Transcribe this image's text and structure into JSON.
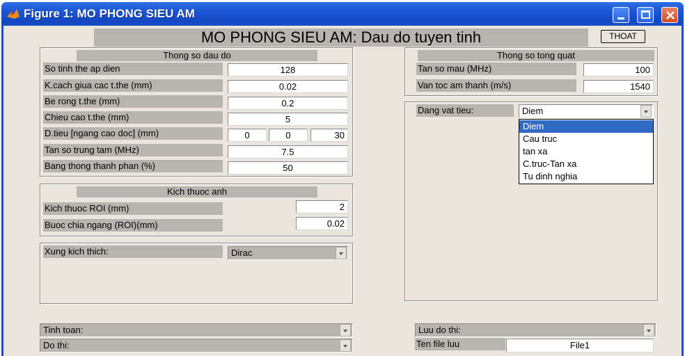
{
  "window": {
    "title": "Figure 1: MO PHONG SIEU AM"
  },
  "heading": "MO PHONG SIEU AM: Dau do tuyen tinh",
  "exit_button": "THOAT",
  "probe_panel": {
    "title": "Thong so dau do",
    "rows": [
      {
        "label": "So tinh the ap dien",
        "value": "128"
      },
      {
        "label": "K.cach giua cac t.the (mm)",
        "value": "0.02"
      },
      {
        "label": "Be rong t.the (mm)",
        "value": "0.2"
      },
      {
        "label": "Chieu cao t.the (mm)",
        "value": "5"
      }
    ],
    "focus_label": "D.tieu [ngang cao doc] (mm)",
    "focus_values": [
      "0",
      "0",
      "30"
    ],
    "center_freq": {
      "label": "Tan so trung tam (MHz)",
      "value": "7.5"
    },
    "bandwidth": {
      "label": "Bang thong thanh phan (%)",
      "value": "50"
    }
  },
  "image_panel": {
    "title": "Kich thuoc anh",
    "roi": {
      "label": "Kich thuoc ROI (mm)",
      "value": "2"
    },
    "step": {
      "label": "Buoc chia ngang (ROI)(mm)",
      "value": "0.02"
    }
  },
  "excitation": {
    "label": "Xung kich thich:",
    "value": "Dirac"
  },
  "general_panel": {
    "title": "Thong so tong quat",
    "sample_rate": {
      "label": "Tan so mau (MHz)",
      "value": "100"
    },
    "sound_speed": {
      "label": "Van toc am thanh (m/s)",
      "value": "1540"
    }
  },
  "target": {
    "label": "Dang vat tieu:",
    "value": "Diem",
    "options": [
      "Diem",
      "Cau truc",
      "tan xa",
      "C.truc-Tan xa",
      "Tu dinh nghia"
    ],
    "selected_index": 0
  },
  "bottom": {
    "compute_label": "Tinh toan:",
    "plot_label": "Do thi:",
    "save_plot_label": "Luu do thi:",
    "file_name_label": "Ten file luu",
    "file_name_value": "File1"
  },
  "colors": {
    "title_bar": "#1a55d4",
    "selection": "#316ac5",
    "panel": "#eae6dd",
    "label_bg": "#b8b5b0"
  }
}
